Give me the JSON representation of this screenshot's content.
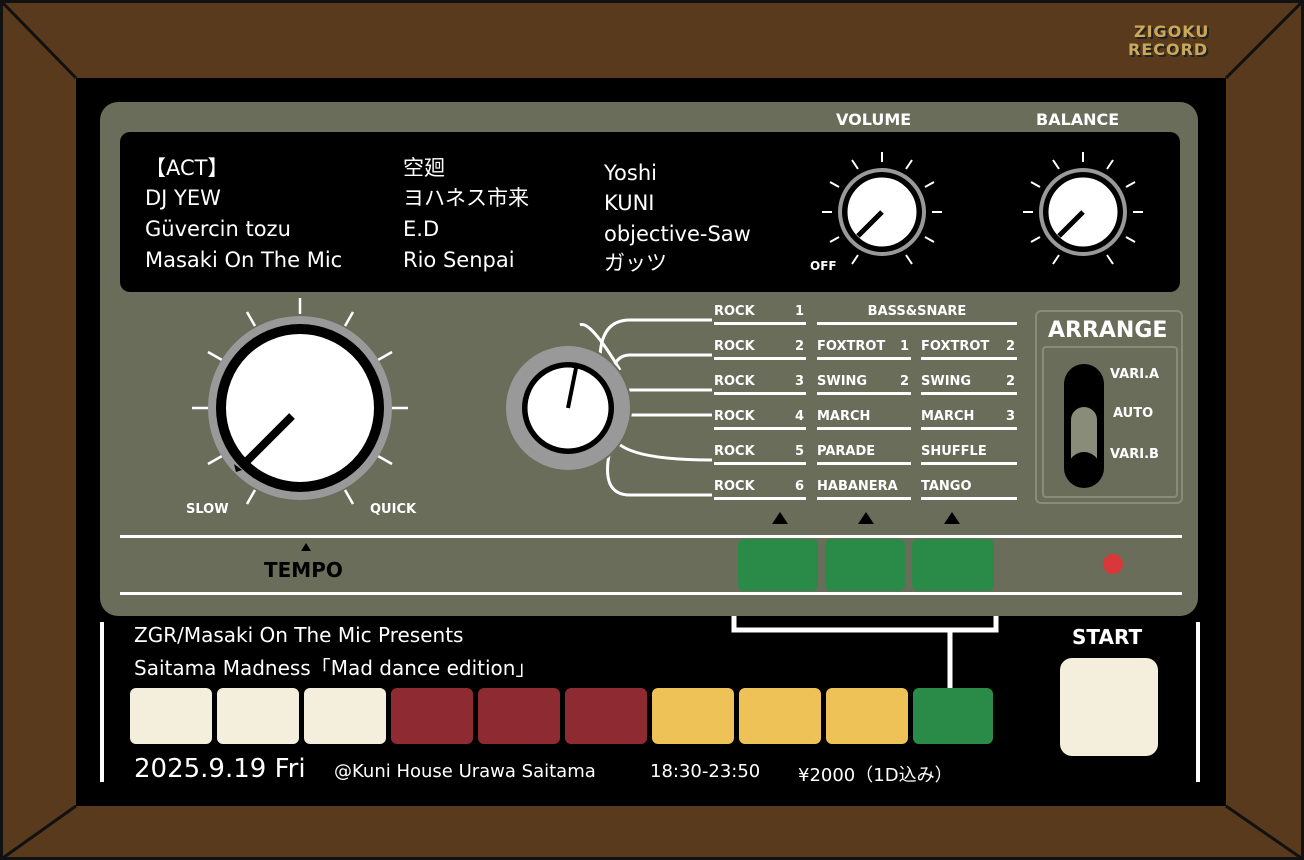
{
  "logo": {
    "line1": "ZIGOKU",
    "line2": "RECORD"
  },
  "acts": {
    "col1": [
      "【ACT】",
      "DJ YEW",
      "Güvercin tozu",
      "Masaki On The Mic"
    ],
    "col2": [
      "空廻",
      "ヨハネス市来",
      "E.D",
      "Rio Senpai"
    ],
    "col3": [
      "Yoshi",
      "KUNI",
      "objective-Saw",
      "ガッツ"
    ]
  },
  "knobs": {
    "volume": "VOLUME",
    "balance": "BALANCE",
    "off": "OFF",
    "slow": "SLOW",
    "quick": "QUICK",
    "tempo": "TEMPO"
  },
  "rhythms": {
    "col1": [
      {
        "name": "ROCK",
        "num": "1"
      },
      {
        "name": "ROCK",
        "num": "2"
      },
      {
        "name": "ROCK",
        "num": "3"
      },
      {
        "name": "ROCK",
        "num": "4"
      },
      {
        "name": "ROCK",
        "num": "5"
      },
      {
        "name": "ROCK",
        "num": "6"
      }
    ],
    "bass_snare": "BASS&SNARE",
    "col2": [
      {
        "name": "FOXTROT",
        "num": "1"
      },
      {
        "name": "SWING",
        "num": "2"
      },
      {
        "name": "MARCH",
        "num": ""
      },
      {
        "name": "PARADE",
        "num": ""
      },
      {
        "name": "HABANERA",
        "num": ""
      }
    ],
    "col3": [
      {
        "name": "FOXTROT",
        "num": "2"
      },
      {
        "name": "SWING",
        "num": "2"
      },
      {
        "name": "MARCH",
        "num": "3"
      },
      {
        "name": "SHUFFLE",
        "num": ""
      },
      {
        "name": "TANGO",
        "num": ""
      }
    ]
  },
  "arrange": {
    "title": "ARRANGE",
    "options": [
      "VARI.A",
      "AUTO",
      "VARI.B"
    ]
  },
  "start_label": "START",
  "event": {
    "presents": "ZGR/Masaki On The Mic Presents",
    "title": "Saitama Madness「Mad dance edition」",
    "date": "2025.9.19 Fri",
    "venue": "@Kuni House Urawa Saitama",
    "time": "18:30-23:50",
    "price": "¥2000（1D込み）"
  },
  "colors": {
    "frame": "#5a3a1c",
    "panel": "#6b6d5b",
    "cream": "#f4eedd",
    "red": "#8e2a32",
    "yellow": "#efc258",
    "green": "#2a8a48",
    "led": "#d8383a"
  }
}
